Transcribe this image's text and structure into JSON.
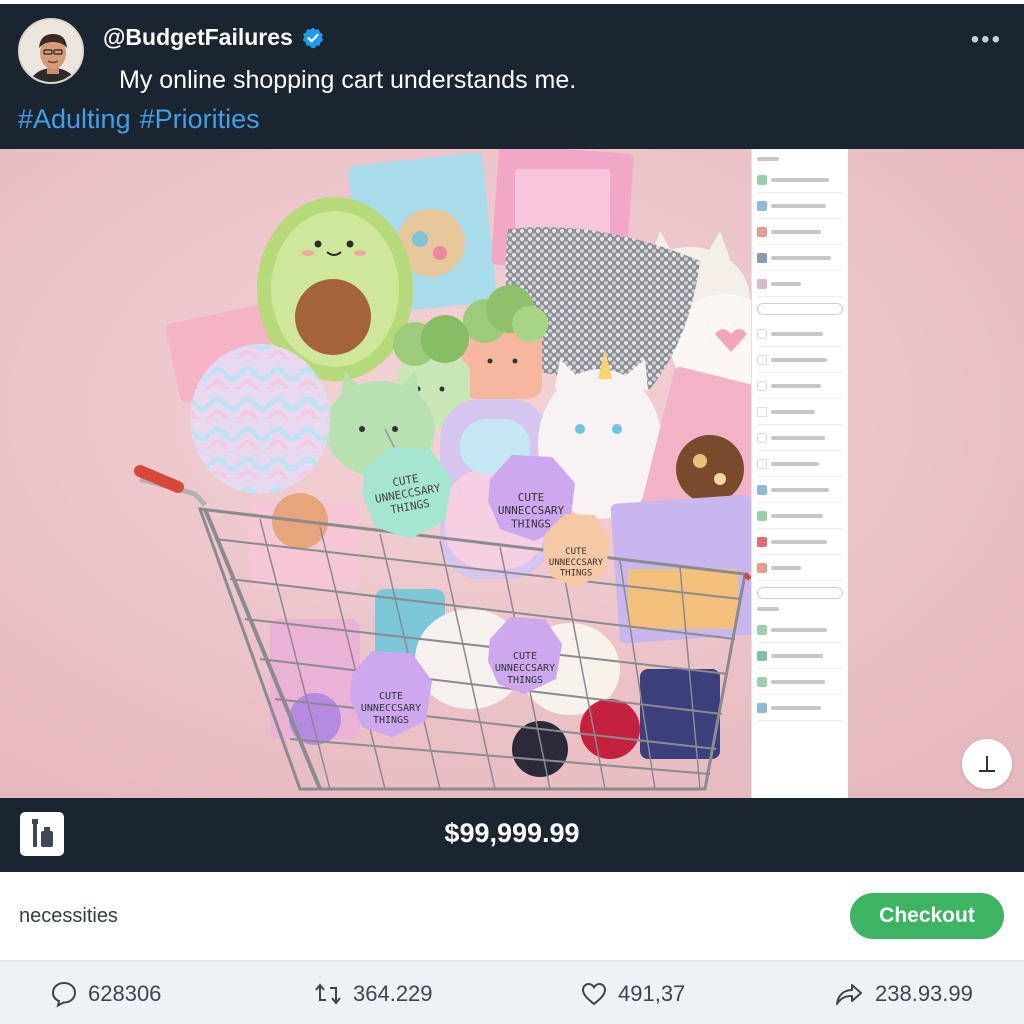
{
  "post": {
    "handle": "@BudgetFailures",
    "verified": true,
    "text": "My online shopping cart understands me.",
    "hashtags": [
      "#Adulting",
      "#Priorities"
    ]
  },
  "image": {
    "tags": [
      "CUTE UNNECCSARY THINGS",
      "CUTE UNNECCSARY THINGS",
      "CUTE UNNECCSARY THINGS",
      "CUTE UNNECCSARY THINGS",
      "CUTE UNNECCSARY THINGS"
    ]
  },
  "cart": {
    "total": "$99,999.99",
    "category": "necessities",
    "checkout_label": "Checkout"
  },
  "actions": {
    "replies": "628306",
    "retweets": "364.229",
    "likes": "491,37",
    "shares": "238.93.99"
  },
  "colors": {
    "header_bg": "#1a2530",
    "hashtag": "#3ea0e8",
    "checkout": "#3db461",
    "verified": "#1d9bf0",
    "image_bg": "#ecc4c9"
  },
  "icons": {
    "verified": "verified-badge-icon",
    "more": "more-dots-icon",
    "download": "download-icon",
    "app": "bottle-app-icon",
    "reply": "comment-icon",
    "retweet": "retweet-icon",
    "like": "heart-icon",
    "share": "share-icon"
  }
}
